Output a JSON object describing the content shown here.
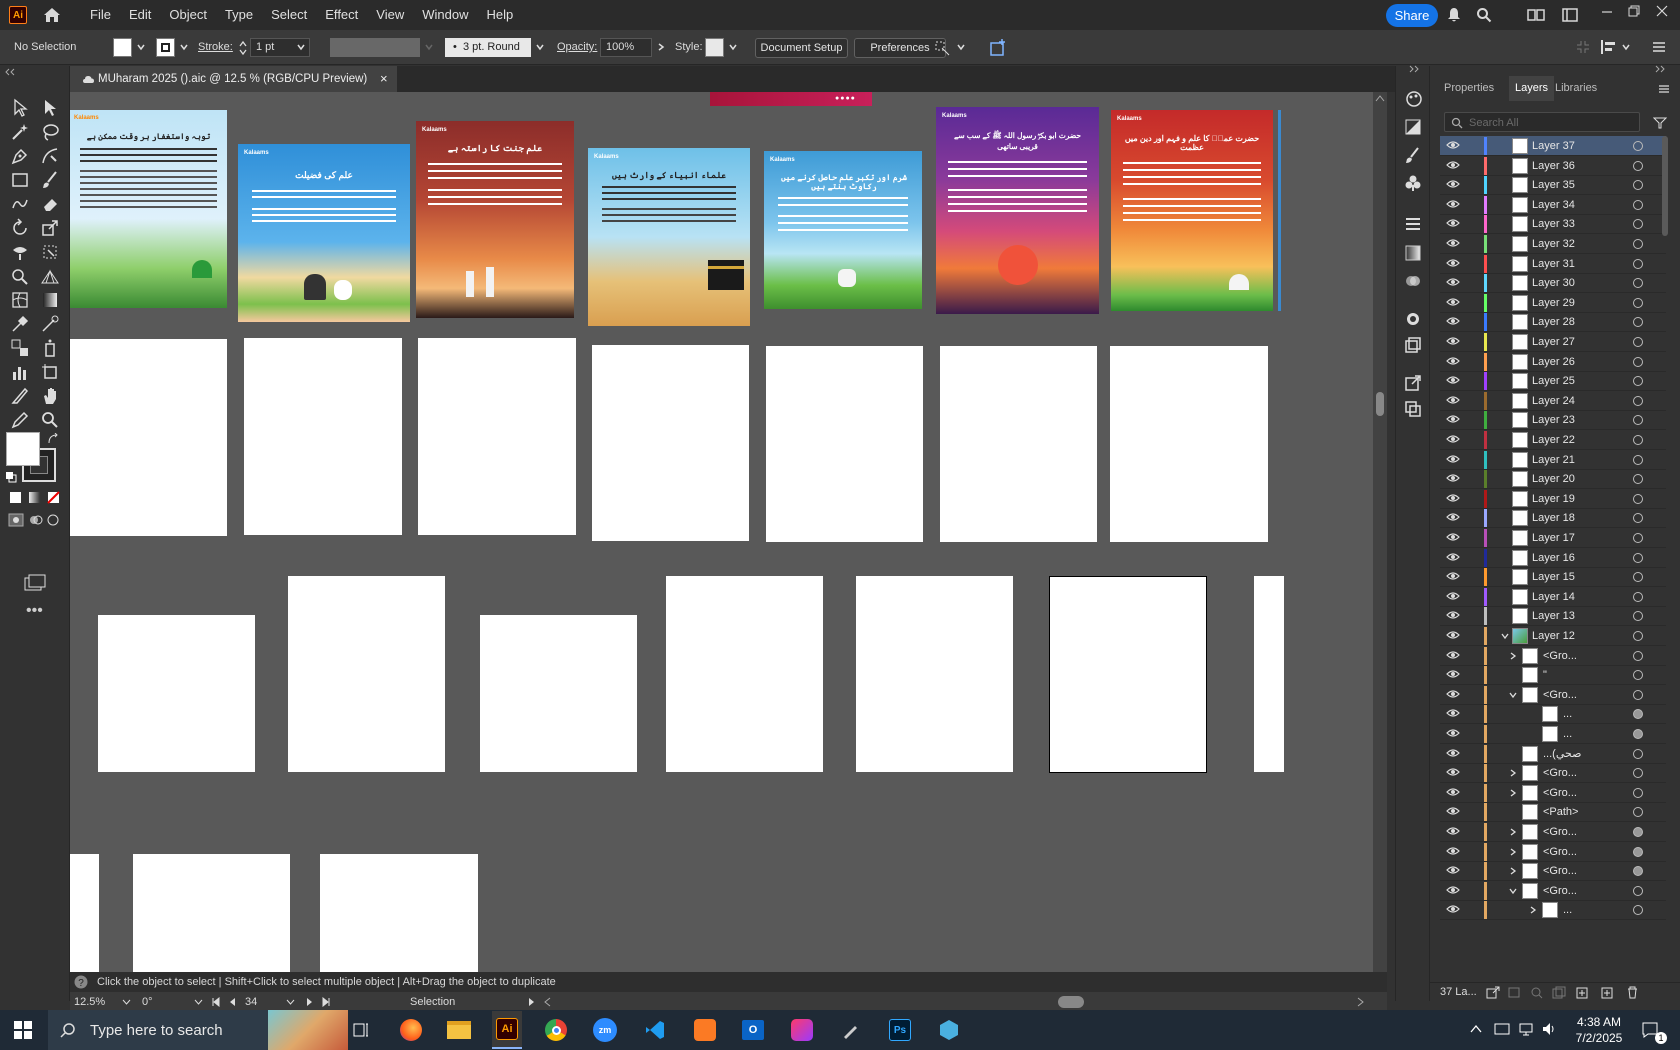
{
  "app": {
    "logo": "Ai",
    "menu": [
      "File",
      "Edit",
      "Object",
      "Type",
      "Select",
      "Effect",
      "View",
      "Window",
      "Help"
    ],
    "share_label": "Share"
  },
  "control_bar": {
    "selection": "No Selection",
    "stroke_label": "Stroke:",
    "stroke_value": "1 pt",
    "brush_value": "3 pt. Round",
    "opacity_label": "Opacity:",
    "opacity_value": "100%",
    "style_label": "Style:",
    "document_setup": "Document Setup",
    "preferences": "Preferences"
  },
  "document": {
    "tab_title": "MUharam 2025 ().aic @ 12.5 % (RGB/CPU Preview)",
    "close": "×"
  },
  "posters": [
    {
      "brand": "Kalaams",
      "title": "توبہ واستغفار ہر وقت ممکن ہے",
      "colors": [
        "#7ac7e8",
        "#4a9d3c"
      ]
    },
    {
      "brand": "Kalaams",
      "title": "علم کی فضیلت",
      "colors": [
        "#3a9be0",
        "#7ec24a"
      ]
    },
    {
      "brand": "Kalaams",
      "title": "علم جنت کا راستہ ہے",
      "colors": [
        "#8b2e2a",
        "#f08e40"
      ]
    },
    {
      "brand": "Kalaams",
      "title": "علماء انبیاء کے وارث ہیں",
      "colors": [
        "#7fc6e6",
        "#e1a95a"
      ]
    },
    {
      "brand": "Kalaams",
      "title": "شرم اور تکبر علم حاصل کرنے میں رکاوٹ بنتے ہیں",
      "colors": [
        "#5aaedc",
        "#78c04a"
      ]
    },
    {
      "brand": "Kalaams",
      "title": "حضرت ابو بکرؓ رسول اللہ ﷺ کے سب سے قریبی ساتھی",
      "colors": [
        "#5a2a8a",
        "#e8553a"
      ]
    },
    {
      "brand": "Kalaams",
      "title": "حضرت عمرؓ کا علم و فہم اور دین میں عظمت",
      "colors": [
        "#c8322a",
        "#f4a43c"
      ]
    }
  ],
  "status": {
    "hint": "Click the object to select  |  Shift+Click to select multiple object  |  Alt+Drag the object to duplicate",
    "zoom": "12.5%",
    "angle": "0°",
    "artboard": "34",
    "tool": "Selection"
  },
  "panel": {
    "tabs": [
      "Properties",
      "Layers",
      "Libraries"
    ],
    "active_tab": "Layers",
    "search_placeholder": "Search All",
    "footer_count": "37 La...",
    "layers": [
      {
        "name": "Layer 37",
        "color": "#4f83ff",
        "selected": true
      },
      {
        "name": "Layer 36",
        "color": "#ff6b6b"
      },
      {
        "name": "Layer 35",
        "color": "#4fd3ff"
      },
      {
        "name": "Layer 34",
        "color": "#e27bff"
      },
      {
        "name": "Layer 33",
        "color": "#ff66cc"
      },
      {
        "name": "Layer 32",
        "color": "#78e078"
      },
      {
        "name": "Layer 31",
        "color": "#ff4f4f"
      },
      {
        "name": "Layer 30",
        "color": "#5fd7ff"
      },
      {
        "name": "Layer 29",
        "color": "#66ff66"
      },
      {
        "name": "Layer 28",
        "color": "#3a7bff"
      },
      {
        "name": "Layer 27",
        "color": "#e8e84f"
      },
      {
        "name": "Layer 26",
        "color": "#ff9f4f"
      },
      {
        "name": "Layer 25",
        "color": "#a040ff"
      },
      {
        "name": "Layer 24",
        "color": "#9c6b2e"
      },
      {
        "name": "Layer 23",
        "color": "#3fae3f"
      },
      {
        "name": "Layer 22",
        "color": "#c03040"
      },
      {
        "name": "Layer 21",
        "color": "#2fbfbf"
      },
      {
        "name": "Layer 20",
        "color": "#5a7f2a"
      },
      {
        "name": "Layer 19",
        "color": "#b01818"
      },
      {
        "name": "Layer 18",
        "color": "#9aa8ff"
      },
      {
        "name": "Layer 17",
        "color": "#b84fb8"
      },
      {
        "name": "Layer 16",
        "color": "#202a9a"
      },
      {
        "name": "Layer 15",
        "color": "#ff9a2e"
      },
      {
        "name": "Layer 14",
        "color": "#a05aff"
      },
      {
        "name": "Layer 13",
        "color": "#bfbfbf"
      },
      {
        "name": "Layer 12",
        "color": "#e3a862",
        "expanded": true
      }
    ],
    "sublayers": [
      {
        "name": "<Gro...",
        "indent": 1,
        "chevron": "right",
        "target": "hollow"
      },
      {
        "name": "\"",
        "indent": 1,
        "chevron": "",
        "target": "hollow"
      },
      {
        "name": "<Gro...",
        "indent": 1,
        "chevron": "down",
        "target": "hollow"
      },
      {
        "name": "...",
        "indent": 2,
        "chevron": "",
        "target": "filled"
      },
      {
        "name": "...",
        "indent": 2,
        "chevron": "",
        "target": "filled"
      },
      {
        "name": "...(صحي",
        "indent": 1,
        "chevron": "",
        "target": "hollow"
      },
      {
        "name": "<Gro...",
        "indent": 1,
        "chevron": "right",
        "target": "hollow"
      },
      {
        "name": "<Gro...",
        "indent": 1,
        "chevron": "right",
        "target": "hollow"
      },
      {
        "name": "<Path>",
        "indent": 1,
        "chevron": "",
        "target": "hollow"
      },
      {
        "name": "<Gro...",
        "indent": 1,
        "chevron": "right",
        "target": "filled"
      },
      {
        "name": "<Gro...",
        "indent": 1,
        "chevron": "right",
        "target": "filled"
      },
      {
        "name": "<Gro...",
        "indent": 1,
        "chevron": "right",
        "target": "filled"
      },
      {
        "name": "<Gro...",
        "indent": 1,
        "chevron": "down",
        "target": "hollow"
      },
      {
        "name": "...",
        "indent": 2,
        "chevron": "right",
        "target": "hollow"
      }
    ]
  },
  "taskbar": {
    "search_placeholder": "Type here to search",
    "time": "4:38 AM",
    "date": "7/2/2025",
    "notification_count": "1",
    "apps": [
      "task-view",
      "firefox",
      "file-explorer",
      "illustrator",
      "chrome",
      "zoom",
      "vscode",
      "xampp",
      "outlook",
      "creative-cloud",
      "pen-tool",
      "photoshop",
      "app"
    ]
  }
}
